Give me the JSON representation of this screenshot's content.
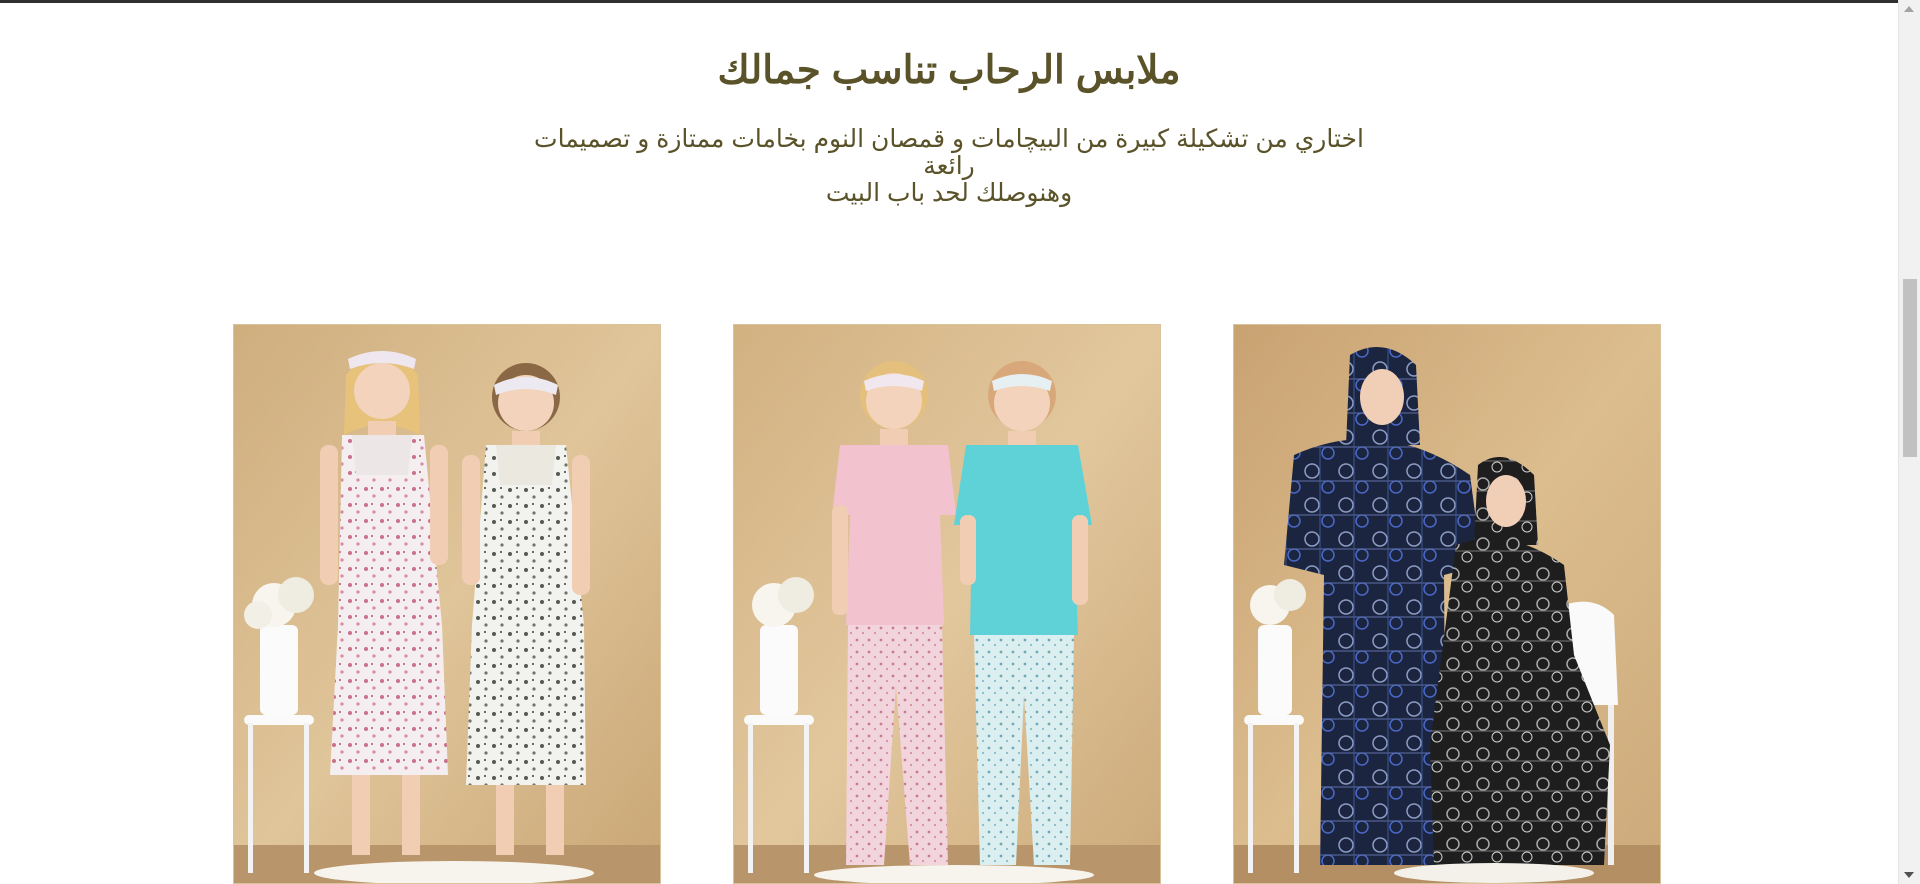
{
  "section": {
    "title": "ملابس الرحاب تناسب جمالك",
    "subtitle_line1": "اختاري من تشكيلة كبيرة من البيچامات و قمصان النوم بخامات ممتازة و تصميمات رائعة",
    "subtitle_line2": "وهنوصلك لحد باب البيت"
  },
  "colors": {
    "heading": "#5a5228",
    "card_background": "#d8b98c",
    "top_border": "#2f2f2f"
  },
  "products": [
    {
      "image": "two-women-floral-nightgowns-photo"
    },
    {
      "image": "two-women-pajama-sets-photo"
    },
    {
      "image": "two-women-printed-abayas-photo"
    }
  ]
}
